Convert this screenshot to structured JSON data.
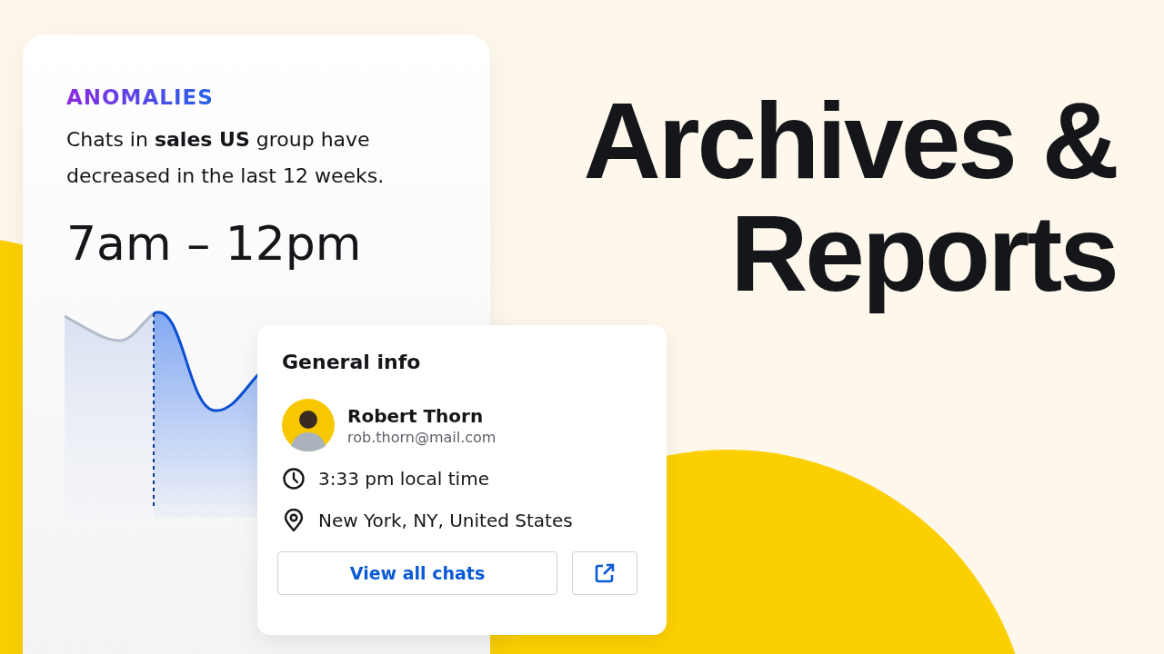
{
  "insight_card": {
    "eyebrow": "ANOMALIES",
    "description": "Chats in **sales US** group have decreased in the last 12 weeks.",
    "time_range": "7am – 12pm"
  },
  "info_card": {
    "title": "General info",
    "contact": {
      "name": "Robert Thorn",
      "email": "rob.thorn@mail.com"
    },
    "details": [
      {
        "kind": "time",
        "text": "3:33 pm local time"
      },
      {
        "kind": "location",
        "text": "New York, NY, United States"
      }
    ],
    "primary_button": "View all chats"
  },
  "headline": [
    "Archives &",
    "Reports"
  ]
}
